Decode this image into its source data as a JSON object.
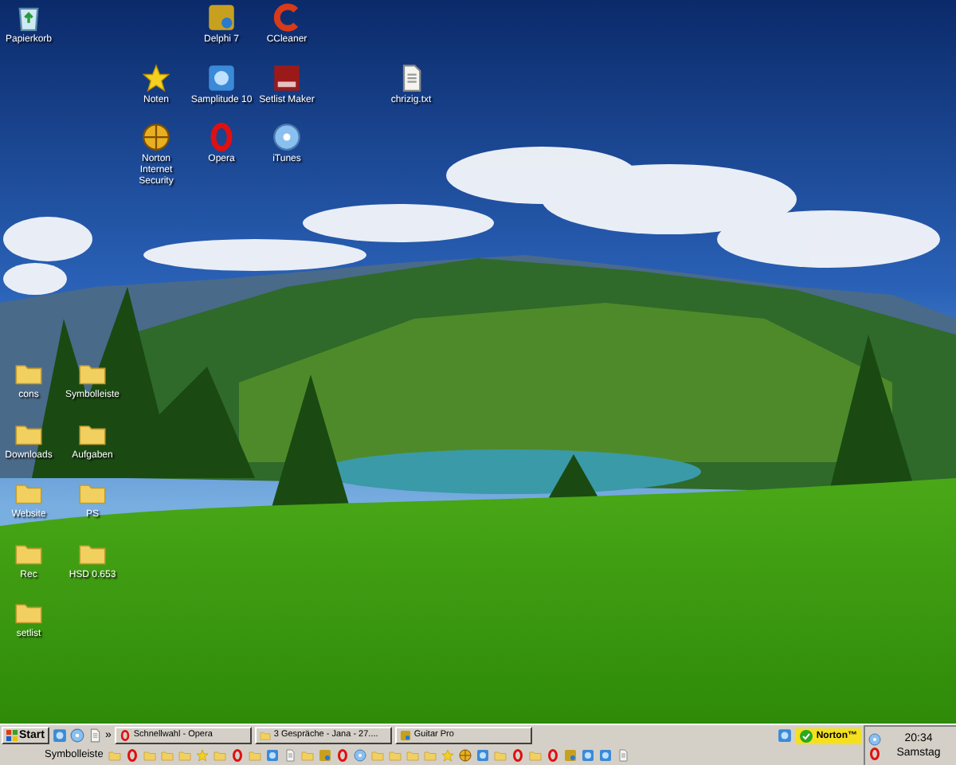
{
  "desktop_icons": [
    {
      "label": "Papierkorb",
      "kind": "recycle-bin"
    },
    {
      "label": "Delphi 7",
      "kind": "tile-gold"
    },
    {
      "label": "CCleaner",
      "kind": "swirl"
    },
    {
      "label": "Noten",
      "kind": "star"
    },
    {
      "label": "Samplitude 10",
      "kind": "tile-blue"
    },
    {
      "label": "Setlist Maker",
      "kind": "tile-red"
    },
    {
      "label": "chrizig.txt",
      "kind": "document"
    },
    {
      "label": "Norton Internet Security",
      "kind": "globe"
    },
    {
      "label": "Opera",
      "kind": "ring"
    },
    {
      "label": "iTunes",
      "kind": "disc"
    },
    {
      "label": "cons",
      "kind": "folder"
    },
    {
      "label": "Symbolleiste",
      "kind": "folder"
    },
    {
      "label": "Downloads",
      "kind": "folder"
    },
    {
      "label": "Aufgaben",
      "kind": "folder"
    },
    {
      "label": "Website",
      "kind": "folder"
    },
    {
      "label": "PS",
      "kind": "folder"
    },
    {
      "label": "Rec",
      "kind": "folder"
    },
    {
      "label": "HSD 0.653",
      "kind": "folder"
    },
    {
      "label": "setlist",
      "kind": "folder"
    }
  ],
  "taskbar": {
    "start": "Start",
    "more": "»",
    "tasks": [
      {
        "label": "Schnellwahl - Opera",
        "kind": "ring"
      },
      {
        "label": "3 Gespräche - Jana - 27....",
        "kind": "folder"
      },
      {
        "label": "Guitar Pro",
        "kind": "tile-gold"
      }
    ],
    "toolbar_label": "Symbolleiste",
    "norton": "Norton™",
    "clock": "20:34",
    "day": "Samstag"
  }
}
